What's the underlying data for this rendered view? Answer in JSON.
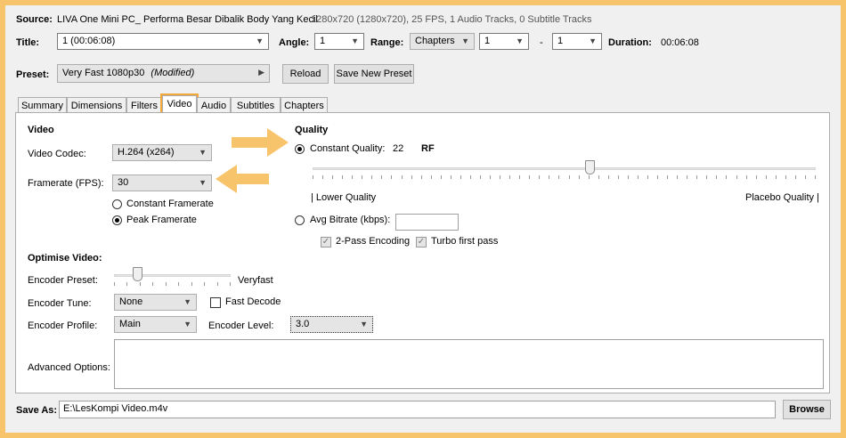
{
  "source": {
    "label": "Source:",
    "title": "LIVA One Mini PC_ Performa Besar Dibalik Body Yang Kecil",
    "info": "1280x720 (1280x720), 25 FPS, 1 Audio Tracks, 0 Subtitle Tracks"
  },
  "title_row": {
    "title_label": "Title:",
    "title_value": "1  (00:06:08)",
    "angle_label": "Angle:",
    "angle_value": "1",
    "range_label": "Range:",
    "range_type": "Chapters",
    "range_start": "1",
    "range_sep": "-",
    "range_end": "1",
    "duration_label": "Duration:",
    "duration_value": "00:06:08"
  },
  "preset": {
    "label": "Preset:",
    "value": "Very Fast 1080p30",
    "modified": "(Modified)",
    "reload_label": "Reload",
    "save_new_label": "Save New Preset"
  },
  "tabs": [
    "Summary",
    "Dimensions",
    "Filters",
    "Video",
    "Audio",
    "Subtitles",
    "Chapters"
  ],
  "video": {
    "section_title": "Video",
    "codec_label": "Video Codec:",
    "codec_value": "H.264 (x264)",
    "framerate_label": "Framerate (FPS):",
    "framerate_value": "30",
    "constant_framerate_label": "Constant Framerate",
    "peak_framerate_label": "Peak Framerate",
    "selected_mode": "Peak Framerate"
  },
  "quality": {
    "section_title": "Quality",
    "constant_quality_label": "Constant Quality:",
    "rf_value": "22",
    "rf_label": "RF",
    "rf_slider_fraction": 0.55,
    "lower_label": "| Lower Quality",
    "placebo_label": "Placebo Quality |",
    "avg_bitrate_label": "Avg Bitrate (kbps):",
    "avg_bitrate_value": "",
    "two_pass_label": "2-Pass Encoding",
    "two_pass_checked": true,
    "turbo_label": "Turbo first pass",
    "turbo_checked": true,
    "selected_mode": "Constant Quality"
  },
  "optimise": {
    "section_title": "Optimise Video:",
    "encoder_preset_label": "Encoder Preset:",
    "encoder_preset_value": "Veryfast",
    "preset_slider_fraction": 0.2,
    "encoder_tune_label": "Encoder Tune:",
    "encoder_tune_value": "None",
    "fast_decode_label": "Fast Decode",
    "fast_decode_checked": false,
    "encoder_profile_label": "Encoder Profile:",
    "encoder_profile_value": "Main",
    "encoder_level_label": "Encoder Level:",
    "encoder_level_value": "3.0",
    "advanced_label": "Advanced Options:",
    "advanced_value": ""
  },
  "save": {
    "label": "Save As:",
    "path": "E:\\LesKompi Video.m4v",
    "browse_label": "Browse"
  },
  "colors": {
    "highlight": "#f7c46b",
    "arrow": "#f7c46b"
  }
}
